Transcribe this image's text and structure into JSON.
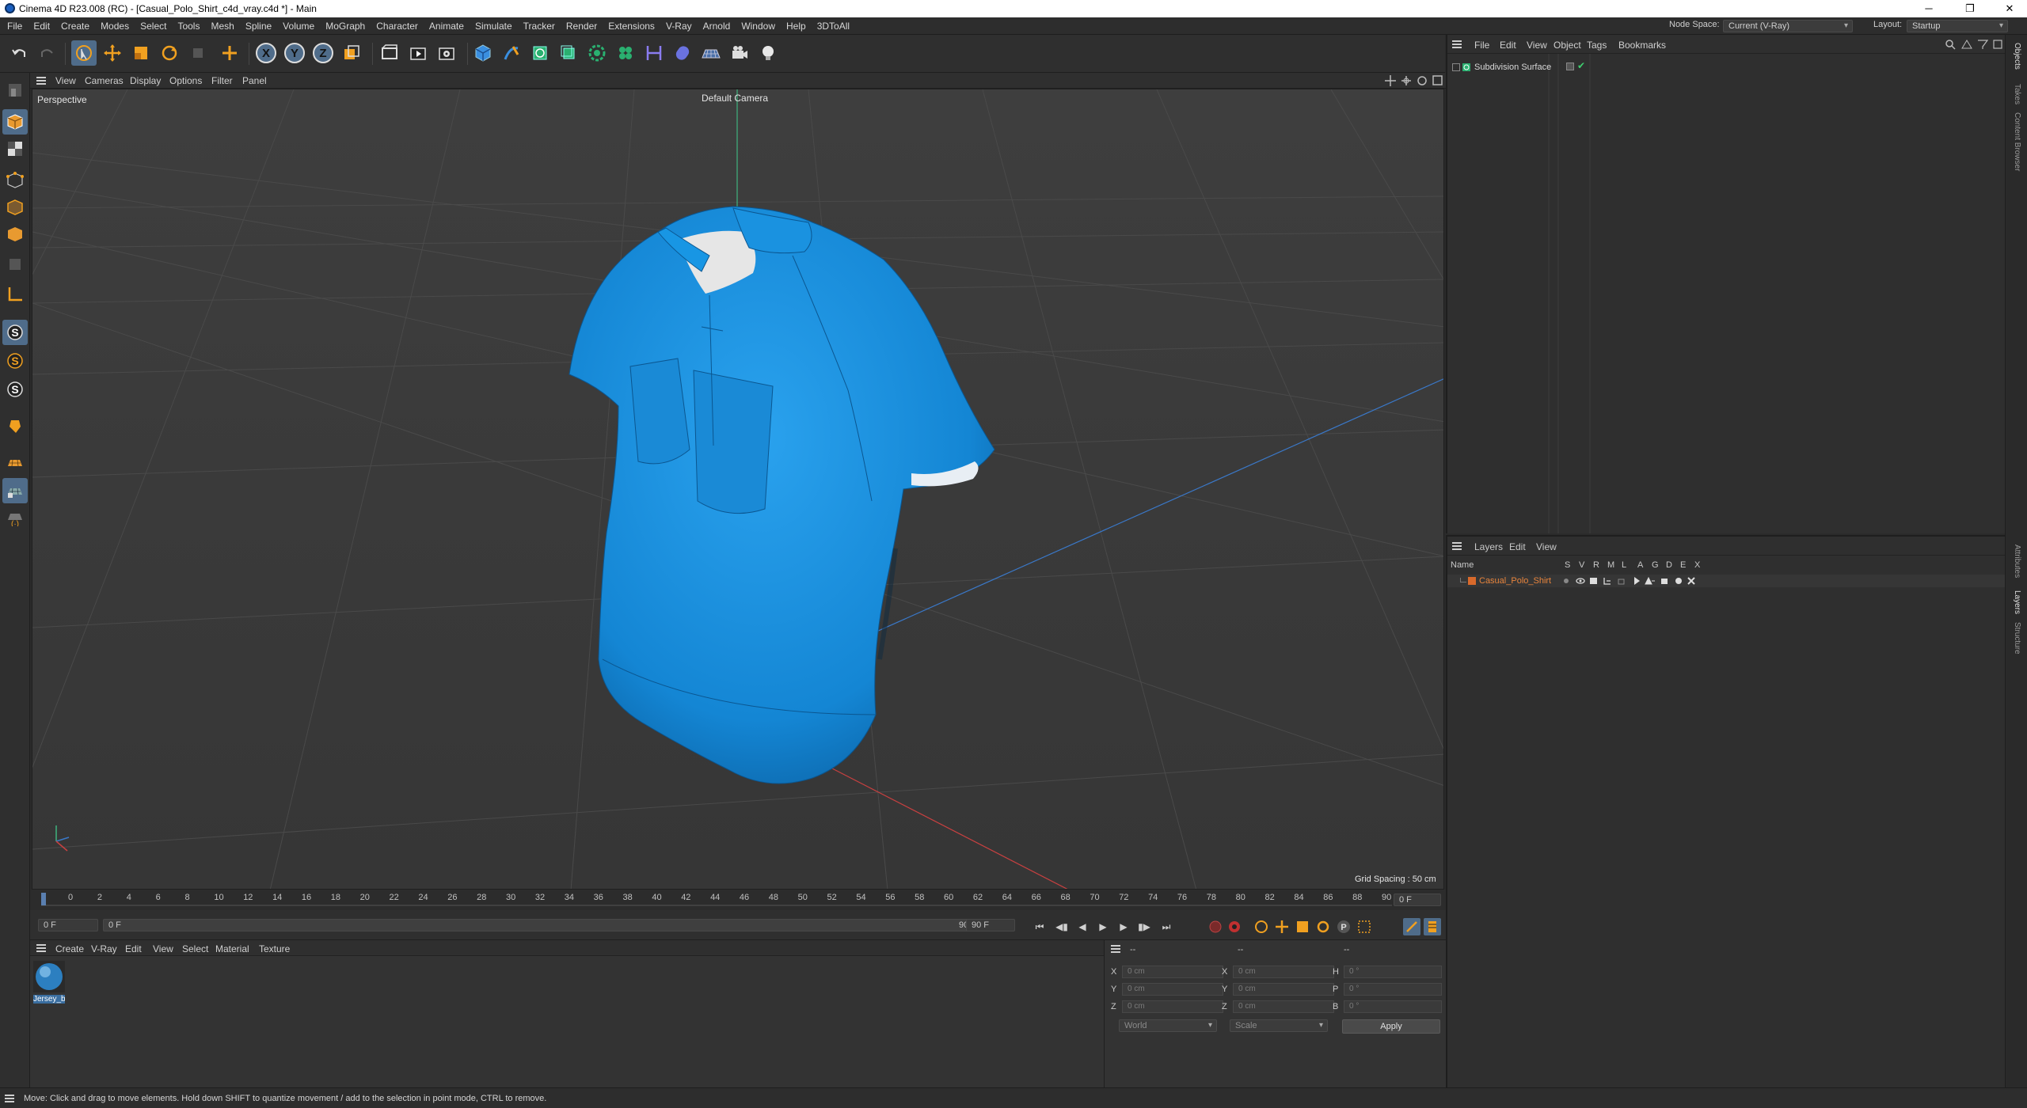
{
  "window": {
    "title": "Cinema 4D R23.008 (RC) - [Casual_Polo_Shirt_c4d_vray.c4d *] - Main",
    "minimize": "─",
    "maximize": "❐",
    "close": "✕"
  },
  "menu": [
    "File",
    "Edit",
    "Create",
    "Modes",
    "Select",
    "Tools",
    "Mesh",
    "Spline",
    "Volume",
    "MoGraph",
    "Character",
    "Animate",
    "Simulate",
    "Tracker",
    "Render",
    "Extensions",
    "V-Ray",
    "Arnold",
    "Window",
    "Help",
    "3DToAll"
  ],
  "node_space": {
    "label": "Node Space:",
    "value": "Current (V-Ray)"
  },
  "layout": {
    "label": "Layout:",
    "value": "Startup"
  },
  "toolbar_icons": [
    "undo-icon",
    "redo-icon",
    "live-selection-icon",
    "move-icon",
    "scale-icon",
    "rotate-icon",
    "recent-tools-icon",
    "create-tool-icon",
    "x-axis-icon",
    "y-axis-icon",
    "z-axis-icon",
    "coordinate-system-icon",
    "render-region-icon",
    "render-view-icon",
    "render-settings-icon",
    "cube-icon",
    "pen-icon",
    "subdivision-icon",
    "extrude-icon",
    "array-icon",
    "cloner-icon",
    "deformer-icon",
    "field-icon",
    "floor-icon",
    "camera-icon",
    "light-icon"
  ],
  "axes_letters": {
    "x": "X",
    "y": "Y",
    "z": "Z"
  },
  "viewport": {
    "menu": [
      "View",
      "Cameras",
      "Display",
      "Options",
      "Filter",
      "Panel"
    ],
    "perspective": "Perspective",
    "camera": "Default Camera",
    "grid_spacing": "Grid Spacing : 50 cm"
  },
  "timeline": {
    "ticks": [
      "0",
      "2",
      "4",
      "6",
      "8",
      "10",
      "12",
      "14",
      "16",
      "18",
      "20",
      "22",
      "24",
      "26",
      "28",
      "30",
      "32",
      "34",
      "36",
      "38",
      "40",
      "42",
      "44",
      "46",
      "48",
      "50",
      "52",
      "54",
      "56",
      "58",
      "60",
      "62",
      "64",
      "66",
      "68",
      "70",
      "72",
      "74",
      "76",
      "78",
      "80",
      "82",
      "84",
      "86",
      "88",
      "90"
    ],
    "end_field": "0 F",
    "current": "0 F",
    "range_start": "0 F",
    "range_end": "90 F",
    "max": "90 F"
  },
  "materials": {
    "menu": [
      "Create",
      "V-Ray",
      "Edit",
      "View",
      "Select",
      "Material",
      "Texture"
    ],
    "items": [
      {
        "name": "Jersey_b"
      }
    ]
  },
  "coordinates": {
    "header": [
      "--",
      "--",
      "--"
    ],
    "rows": [
      {
        "a": "X",
        "av": "0 cm",
        "b": "X",
        "bv": "0 cm",
        "c": "H",
        "cv": "0 °"
      },
      {
        "a": "Y",
        "av": "0 cm",
        "b": "Y",
        "bv": "0 cm",
        "c": "P",
        "cv": "0 °"
      },
      {
        "a": "Z",
        "av": "0 cm",
        "b": "Z",
        "bv": "0 cm",
        "c": "B",
        "cv": "0 °"
      }
    ],
    "mode": "World",
    "transform": "Scale",
    "apply": "Apply"
  },
  "object_manager": {
    "menu": [
      "File",
      "Edit",
      "View",
      "Object",
      "Tags",
      "Bookmarks"
    ],
    "items": [
      {
        "name": "Subdivision Surface"
      }
    ]
  },
  "layer_manager": {
    "menu": [
      "Layers",
      "Edit",
      "View"
    ],
    "columns": [
      "Name",
      "S",
      "V",
      "R",
      "M",
      "L",
      "A",
      "G",
      "D",
      "E",
      "X"
    ],
    "items": [
      {
        "name": "Casual_Polo_Shirt",
        "color": "#d8692b"
      }
    ]
  },
  "side_tabs": {
    "top": [
      "Objects",
      "Takes",
      "Content Browser"
    ],
    "bottom": [
      "Attributes",
      "Layers",
      "Structure"
    ]
  },
  "status": "Move: Click and drag to move elements. Hold down SHIFT to quantize movement / add to the selection in point mode, CTRL to remove.",
  "colors": {
    "shirt": "#1a8fdc",
    "accent": "#4f6c8a",
    "layer": "#d8692b"
  }
}
